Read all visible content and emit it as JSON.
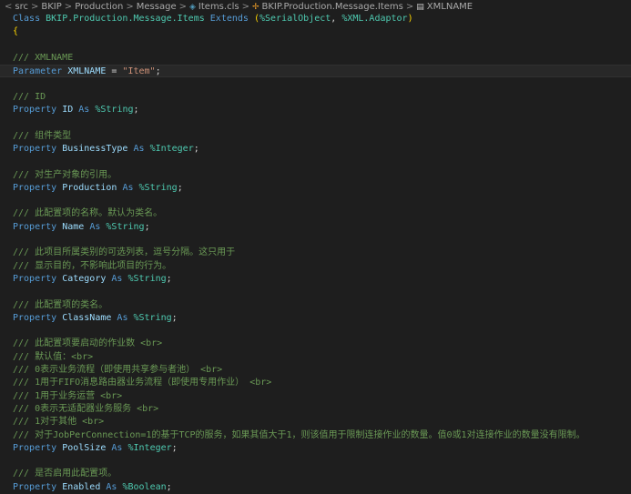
{
  "breadcrumb": {
    "items": [
      "src",
      "BKIP",
      "Production",
      "Message",
      "Items.cls",
      "BKIP.Production.Message.Items",
      "XMLNAME"
    ],
    "separator": ">"
  },
  "code": {
    "class_kw": "Class",
    "class_name": "BKIP.Production.Message.Items",
    "extends_kw": "Extends",
    "open_paren": "(",
    "super1": "%SerialObject",
    "comma": ", ",
    "super2": "%XML.Adaptor",
    "close_paren": ")",
    "open_brace": "{",
    "xmlname_comment": "/// XMLNAME",
    "param_kw": "Parameter",
    "param_name": "XMLNAME",
    "param_eq": " = ",
    "param_value": "\"Item\"",
    "param_semi": ";",
    "property_kw": "Property",
    "as_kw": "As",
    "semi": ";",
    "properties": [
      {
        "comments": [
          "/// ID"
        ],
        "name": "ID",
        "type": "%String"
      },
      {
        "comments": [
          "/// 组件类型"
        ],
        "name": "BusinessType",
        "type": "%Integer"
      },
      {
        "comments": [
          "/// 对生产对象的引用。"
        ],
        "name": "Production",
        "type": "%String"
      },
      {
        "comments": [
          "/// 此配置项的名称。默认为类名。"
        ],
        "name": "Name",
        "type": "%String"
      },
      {
        "comments": [
          "/// 此项目所属类别的可选列表，逗号分隔。这只用于",
          "/// 显示目的，不影响此项目的行为。"
        ],
        "name": "Category",
        "type": "%String"
      },
      {
        "comments": [
          "/// 此配置项的类名。"
        ],
        "name": "ClassName",
        "type": "%String"
      },
      {
        "comments": [
          "/// 此配置项要启动的作业数 <br>",
          "/// 默认值：<br>",
          "/// 0表示业务流程（即使用共享参与者池） <br>",
          "/// 1用于FIFO消息路由器业务流程（即使用专用作业） <br>",
          "/// 1用于业务运营 <br>",
          "/// 0表示无适配器业务服务 <br>",
          "/// 1对于其他 <br>",
          "/// 对于JobPerConnection=1的基于TCP的服务，如果其值大于1，则该值用于限制连接作业的数量。值0或1对连接作业的数量没有限制。"
        ],
        "name": "PoolSize",
        "type": "%Integer"
      },
      {
        "comments": [
          "/// 是否启用此配置项。"
        ],
        "name": "Enabled",
        "type": "%Boolean"
      }
    ]
  }
}
